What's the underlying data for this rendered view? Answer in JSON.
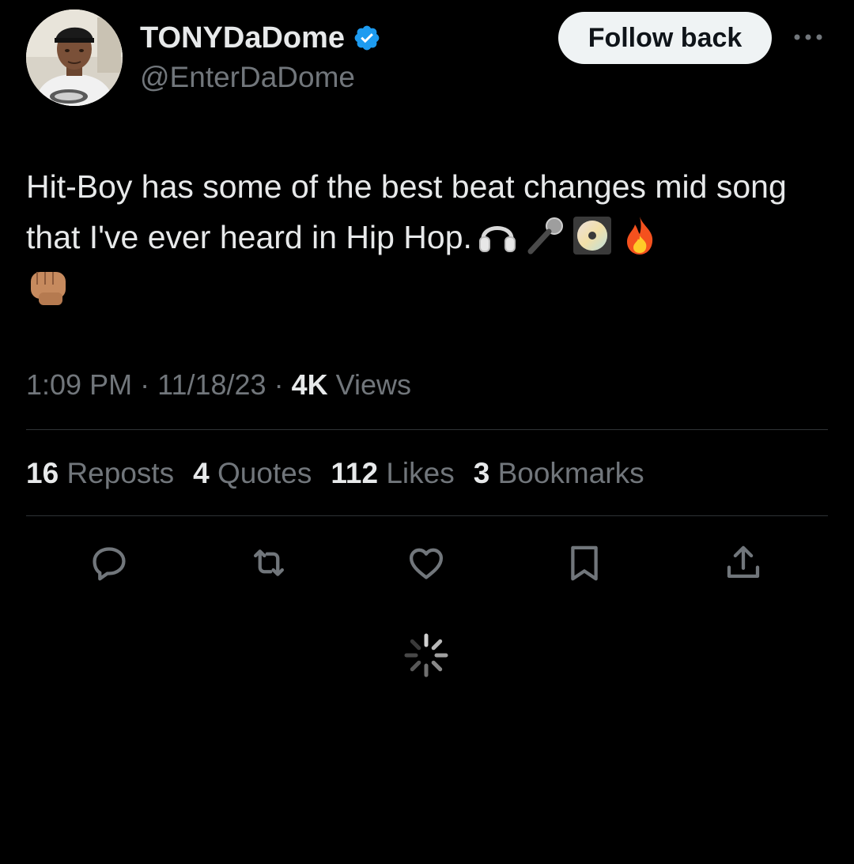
{
  "author": {
    "display_name": "TONYDaDome",
    "handle": "@EnterDaDome",
    "verified": true
  },
  "header": {
    "follow_label": "Follow back"
  },
  "tweet": {
    "text": "Hit-Boy has some of the best beat changes mid song that I've ever heard in Hip Hop.",
    "emojis": [
      "headphones-icon",
      "microphone-icon",
      "cd-icon",
      "fire-icon",
      "fist-icon"
    ]
  },
  "meta": {
    "time": "1:09 PM",
    "date": "11/18/23",
    "views_count": "4K",
    "views_label": "Views"
  },
  "stats": [
    {
      "count": "16",
      "label": "Reposts"
    },
    {
      "count": "4",
      "label": "Quotes"
    },
    {
      "count": "112",
      "label": "Likes"
    },
    {
      "count": "3",
      "label": "Bookmarks"
    }
  ],
  "actions": [
    "reply-icon",
    "repost-icon",
    "like-icon",
    "bookmark-icon",
    "share-icon"
  ],
  "colors": {
    "background": "#000000",
    "text_primary": "#e7e9ea",
    "text_secondary": "#71767b",
    "divider": "#2f3336",
    "verified_blue": "#1d9bf0",
    "button_bg": "#eff3f4"
  }
}
